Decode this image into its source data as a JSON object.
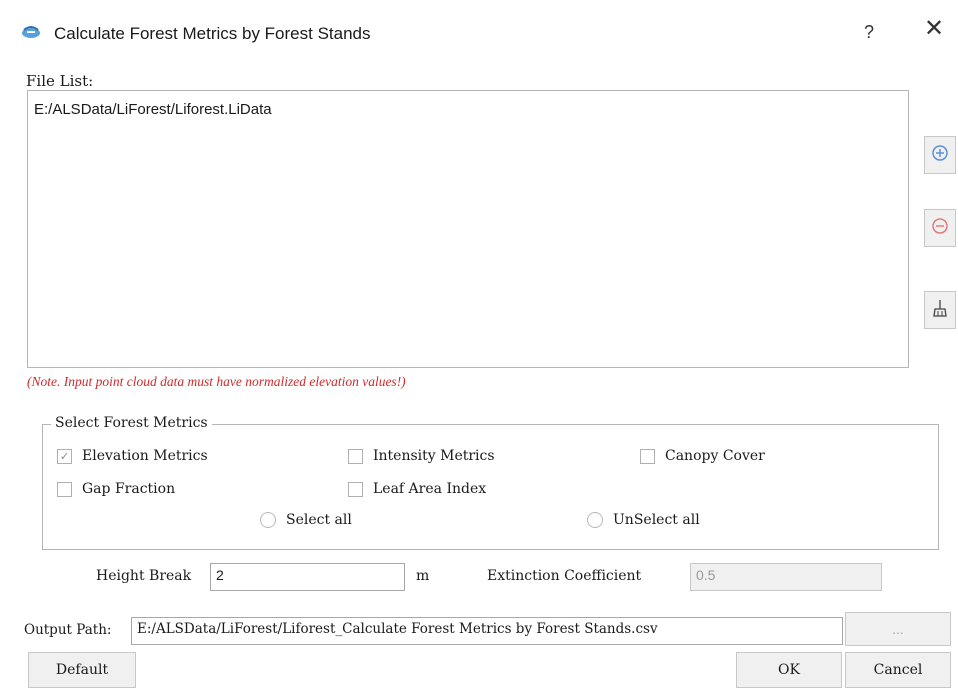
{
  "window": {
    "title": "Calculate Forest Metrics by Forest Stands",
    "help_glyph": "?",
    "close_glyph": "✕"
  },
  "file_list": {
    "label": "File List:",
    "items": [
      "E:/ALSData/LiForest/Liforest.LiData"
    ]
  },
  "side_buttons": {
    "add_icon": "plus-circle-icon",
    "remove_icon": "minus-circle-icon",
    "clear_icon": "broom-icon"
  },
  "note": "(Note. Input point cloud data must have normalized elevation values!)",
  "metrics": {
    "title": "Select Forest Metrics",
    "options": [
      {
        "label": "Elevation Metrics",
        "checked": true
      },
      {
        "label": "Intensity Metrics",
        "checked": false
      },
      {
        "label": "Canopy Cover",
        "checked": false
      },
      {
        "label": "Gap Fraction",
        "checked": false
      },
      {
        "label": "Leaf Area Index",
        "checked": false
      }
    ],
    "select_all": "Select all",
    "unselect_all": "UnSelect all"
  },
  "params": {
    "height_break_label": "Height Break",
    "height_break_value": "2",
    "height_break_unit": "m",
    "extinction_label": "Extinction Coefficient",
    "extinction_value": "0.5"
  },
  "output": {
    "label": "Output Path:",
    "value": "E:/ALSData/LiForest/Liforest_Calculate Forest Metrics by Forest Stands.csv",
    "browse_label": "..."
  },
  "buttons": {
    "default": "Default",
    "ok": "OK",
    "cancel": "Cancel"
  },
  "colors": {
    "note": "#d02a2a",
    "add_icon": "#5b8fd8",
    "remove_icon": "#e07b7b"
  }
}
